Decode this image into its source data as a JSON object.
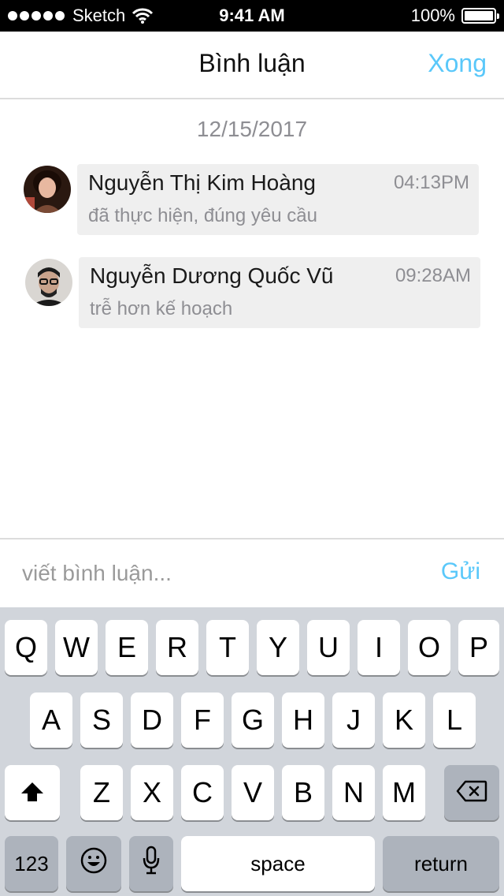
{
  "status_bar": {
    "carrier": "Sketch",
    "time": "9:41 AM",
    "battery": "100%"
  },
  "nav": {
    "title": "Bình luận",
    "done_label": "Xong"
  },
  "comments": {
    "date": "12/15/2017",
    "items": [
      {
        "author": "Nguyễn Thị Kim Hoàng",
        "time": "04:13PM",
        "text": "đã thực hiện, đúng yêu cầu",
        "avatar": "avatar-woman"
      },
      {
        "author": "Nguyễn Dương Quốc Vũ",
        "time": "09:28AM",
        "text": "trễ hơn kế hoạch",
        "avatar": "avatar-man"
      }
    ]
  },
  "composer": {
    "placeholder": "viết bình luận...",
    "value": "",
    "send_label": "Gửi"
  },
  "keyboard": {
    "row1": [
      "Q",
      "W",
      "E",
      "R",
      "T",
      "Y",
      "U",
      "I",
      "O",
      "P"
    ],
    "row2": [
      "A",
      "S",
      "D",
      "F",
      "G",
      "H",
      "J",
      "K",
      "L"
    ],
    "row3": [
      "Z",
      "X",
      "C",
      "V",
      "B",
      "N",
      "M"
    ],
    "numbers_label": "123",
    "space_label": "space",
    "return_label": "return",
    "shift_icon": "shift-arrow-icon",
    "delete_icon": "backspace-icon",
    "emoji_icon": "emoji-icon",
    "mic_icon": "microphone-icon"
  },
  "colors": {
    "accent": "#5ac8fa",
    "bubble": "#efefef",
    "muted": "#8e8e93",
    "keyboard_bg": "#d1d5db",
    "dark_key": "#adb3bc"
  }
}
